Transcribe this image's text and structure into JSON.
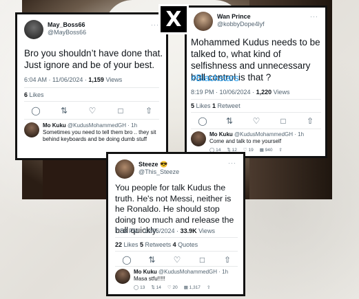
{
  "x_logo": "X",
  "tweet1": {
    "name": "May_Boss66",
    "handle": "@MayBoss66",
    "text": "Bro you shouldn’t have done that. Just ignore and be of your best.",
    "time": "6:04 AM · 11/06/2024 · ",
    "views": "1,159",
    "views_label": " Views",
    "likes": "6",
    "likes_label": " Likes",
    "reply": {
      "name": "Mo Kuku",
      "handle": " @KudusMohammedGH · 1h",
      "text": "Sometimes you need to tell them bro .. they sit behind keyboards and be doing dumb stuff"
    }
  },
  "tweet2": {
    "name": "Wan Prince",
    "handle": "@kobbyDope4lyf",
    "text": "Mohammed Kudus needs to be talked to, what kind of selfishness and unnecessary ball control is that ?",
    "hashtag": "#Blackstars",
    "time": "8:19 PM · 10/06/2024 · ",
    "views": "1,220",
    "views_label": " Views",
    "likes": "5",
    "likes_label": " Likes ",
    "retweets": "1",
    "retweets_label": " Retweet",
    "reply": {
      "name": "Mo Kuku",
      "handle": " @KudusMohammedGH · 1h",
      "text": "Come and talk to me yourself",
      "stats": [
        "14",
        "12",
        "19",
        "940"
      ]
    }
  },
  "tweet3": {
    "name": "Steeze 😎",
    "handle": "@This_Steeze",
    "text": "You people for talk Kudus the truth. He's not Messi, neither is he Ronaldo. He should stop doing too much and release the ball quickly.",
    "time": "7:58 PM · 10/06/2024 · ",
    "views": "33.9K",
    "views_label": " Views",
    "likes": "22",
    "likes_label": " Likes ",
    "retweets": "5",
    "retweets_label": " Retweets ",
    "quotes": "4",
    "quotes_label": " Quotes",
    "reply": {
      "name": "Mo Kuku",
      "handle": " @KudusMohammedGH · 1h",
      "text": "Masa stfu!!!!!",
      "stats": [
        "13",
        "14",
        "20",
        "1,317"
      ]
    }
  },
  "colors": {
    "hashtag": "#1d9bf0",
    "muted": "#536471",
    "border": "#111111"
  }
}
